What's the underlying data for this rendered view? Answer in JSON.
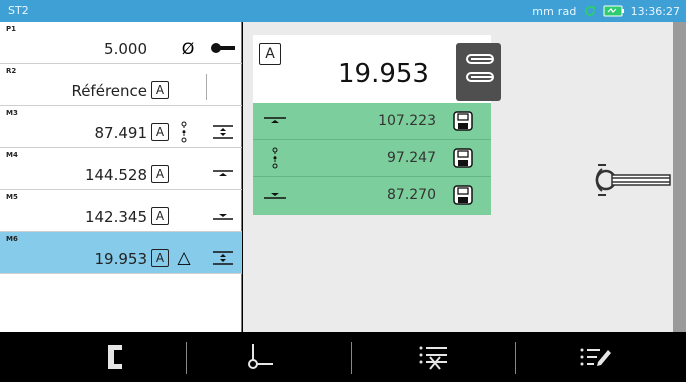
{
  "window": {
    "title": "ST2"
  },
  "status": {
    "units": "mm rad",
    "time": "13:36:27"
  },
  "measurements": [
    {
      "tag": "P1",
      "value": "5.000",
      "box": "",
      "symbol": "diameter-icon",
      "symbol_char": "Ø",
      "icon2": "probe-icon"
    },
    {
      "tag": "R2",
      "value": "Référence",
      "box": "A",
      "symbol": "",
      "symbol_char": "",
      "icon2": ""
    },
    {
      "tag": "M3",
      "value": "87.491",
      "box": "A",
      "symbol": "vertical-distance-icon",
      "symbol_char": "",
      "icon2": "top-bottom-icon"
    },
    {
      "tag": "M4",
      "value": "144.528",
      "box": "A",
      "symbol": "",
      "symbol_char": "",
      "icon2": "top-line-icon"
    },
    {
      "tag": "M5",
      "value": "142.345",
      "box": "A",
      "symbol": "",
      "symbol_char": "",
      "icon2": "bottom-line-icon"
    },
    {
      "tag": "M6",
      "value": "19.953",
      "box": "A",
      "symbol": "triangle-icon",
      "symbol_char": "△",
      "icon2": "top-bottom-icon"
    }
  ],
  "result": {
    "box": "A",
    "value": "19.953"
  },
  "sub_results": [
    {
      "icon": "top-line-icon",
      "value": "107.223"
    },
    {
      "icon": "vertical-distance-icon",
      "value": "97.247"
    },
    {
      "icon": "bottom-line-icon",
      "value": "87.270"
    }
  ],
  "colors": {
    "topbar": "#3fa0d6",
    "selected": "#86cbea",
    "green": "#7ccf9c"
  },
  "toolbar": [
    "bracket-icon",
    "probe-point-icon",
    "clear-list-icon",
    "edit-list-icon"
  ]
}
